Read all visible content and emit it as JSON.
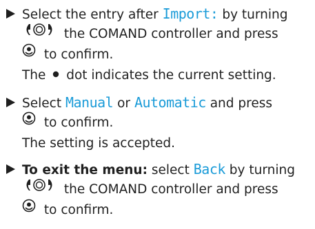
{
  "step1": {
    "select_text": "Select the entry after",
    "menu_term": "Import:",
    "by_turning": "by turning",
    "controller_text": "the COMAND controller and press",
    "confirm_text": "to confirm.",
    "note_prefix": "The",
    "note_suffix": "dot indicates the current setting."
  },
  "step2": {
    "select_text": "Select",
    "option_manual": "Manual",
    "or_text": "or",
    "option_automatic": "Automatic",
    "and_press": "and press",
    "confirm_text": "to confirm.",
    "result_text": "The setting is accepted."
  },
  "step3": {
    "bold_intro": "To exit the menu:",
    "select_text": "select",
    "menu_term": "Back",
    "by_turning": "by turning",
    "controller_text": "the COMAND controller and press",
    "confirm_text": "to confirm."
  },
  "icons": {
    "bullet": "triangle-bullet-icon",
    "controller": "turn-controller-icon",
    "press": "press-controller-icon",
    "dot": "filled-dot-icon"
  },
  "colors": {
    "menu_term": "#1a9bd8",
    "text": "#1f1f1f"
  }
}
